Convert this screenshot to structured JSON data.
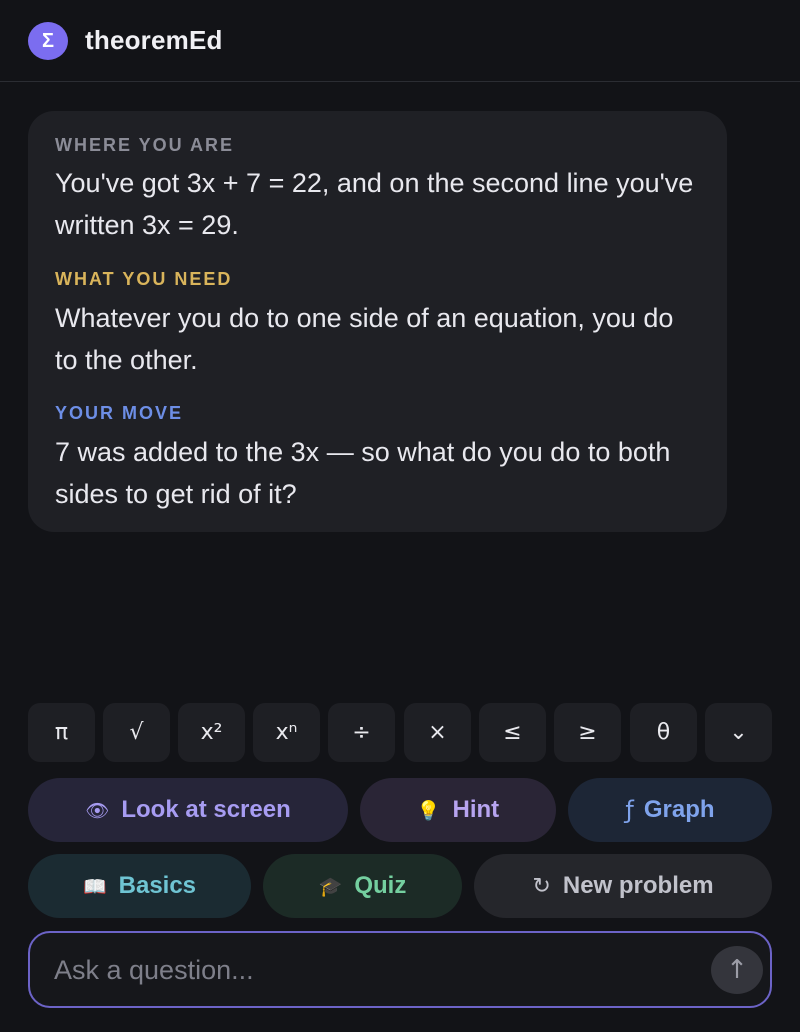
{
  "app": {
    "logo_glyph": "Σ",
    "title": "theoremEd",
    "accent_color": "#7b6df0"
  },
  "message": {
    "where": {
      "label": "WHERE YOU ARE",
      "text": "You've got 3x + 7 = 22, and on the second line you've written 3x = 29."
    },
    "need": {
      "label": "WHAT YOU NEED",
      "text": "Whatever you do to one side of an equation, you do to the other."
    },
    "move": {
      "label": "YOUR MOVE",
      "text": "7 was added to the 3x — so what do you do to both sides to get rid of it?"
    }
  },
  "keypad": {
    "keys": [
      {
        "label": "π",
        "name": "pi"
      },
      {
        "label": "√",
        "name": "sqrt"
      },
      {
        "label": "x²",
        "name": "square"
      },
      {
        "label": "xⁿ",
        "name": "power"
      },
      {
        "label": "÷",
        "name": "divide"
      },
      {
        "label": "×",
        "name": "multiply"
      },
      {
        "label": "≤",
        "name": "less-equal"
      },
      {
        "label": "≥",
        "name": "greater-equal"
      },
      {
        "label": "θ",
        "name": "theta"
      },
      {
        "label": "⌄",
        "name": "more"
      }
    ]
  },
  "actions": {
    "look": {
      "icon": "👁",
      "icon_name": "eye-icon",
      "label": "Look at screen"
    },
    "hint": {
      "icon": "💡",
      "icon_name": "lightbulb-icon",
      "label": "Hint"
    },
    "graph": {
      "icon": "ƒ",
      "icon_name": "function-icon",
      "label": "Graph"
    },
    "basics": {
      "icon": "📖",
      "icon_name": "book-icon",
      "label": "Basics"
    },
    "quiz": {
      "icon": "🎓",
      "icon_name": "graduation-cap-icon",
      "label": "Quiz"
    },
    "new_problem": {
      "icon": "↻",
      "icon_name": "refresh-icon",
      "label": "New problem"
    }
  },
  "input": {
    "placeholder": "Ask a question...",
    "value": "",
    "send_icon": "↑"
  }
}
